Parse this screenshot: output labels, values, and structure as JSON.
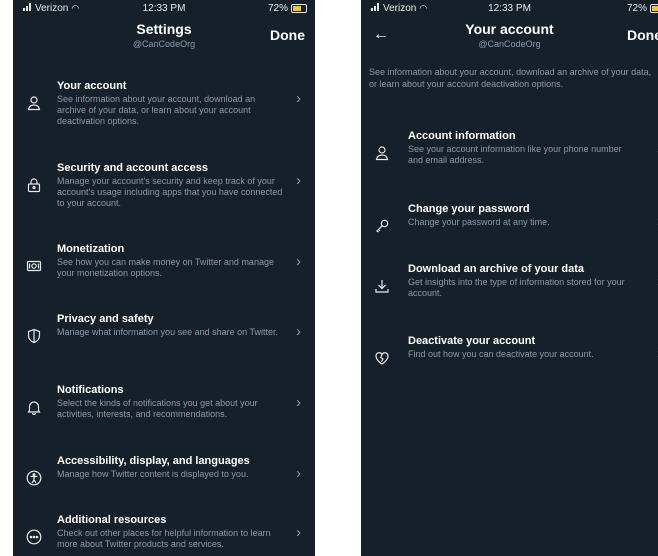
{
  "left": {
    "status": {
      "carrier": "Verizon",
      "time": "12:33 PM",
      "battery": "72%"
    },
    "header": {
      "title": "Settings",
      "subtitle": "@CanCodeOrg",
      "done": "Done"
    },
    "items": [
      {
        "icon": "person-icon",
        "title": "Your account",
        "desc": "See information about your account, download an archive of your data, or learn about your account deactivation options."
      },
      {
        "icon": "lock-icon",
        "title": "Security and account access",
        "desc": "Manage your account's security and keep track of your account's usage including apps that you have connected to your account."
      },
      {
        "icon": "money-icon",
        "title": "Monetization",
        "desc": "See how you can make money on Twitter and manage your monetization options."
      },
      {
        "icon": "shield-icon",
        "title": "Privacy and safety",
        "desc": "Manage what information you see and share on Twitter."
      },
      {
        "icon": "bell-icon",
        "title": "Notifications",
        "desc": "Select the kinds of notifications you get about your activities, interests, and recommendations."
      },
      {
        "icon": "accessibility-icon",
        "title": "Accessibility, display, and languages",
        "desc": "Manage how Twitter content is displayed to you."
      },
      {
        "icon": "more-icon",
        "title": "Additional resources",
        "desc": "Check out other places for helpful information to learn more about Twitter products and services."
      }
    ]
  },
  "right": {
    "status": {
      "carrier": "Verizon",
      "time": "12:33 PM",
      "battery": "72%"
    },
    "header": {
      "title": "Your account",
      "subtitle": "@CanCodeOrg",
      "done": "Done"
    },
    "intro": "See information about your account, download an archive of your data, or learn about your account deactivation options.",
    "items": [
      {
        "icon": "person-icon",
        "title": "Account information",
        "desc": "See your account information like your phone number and email address."
      },
      {
        "icon": "key-icon",
        "title": "Change your password",
        "desc": "Change your password at any time."
      },
      {
        "icon": "download-icon",
        "title": "Download an archive of your data",
        "desc": "Get insights into the type of information stored for your account."
      },
      {
        "icon": "broken-heart-icon",
        "title": "Deactivate your account",
        "desc": "Find out how you can deactivate your account."
      }
    ]
  }
}
